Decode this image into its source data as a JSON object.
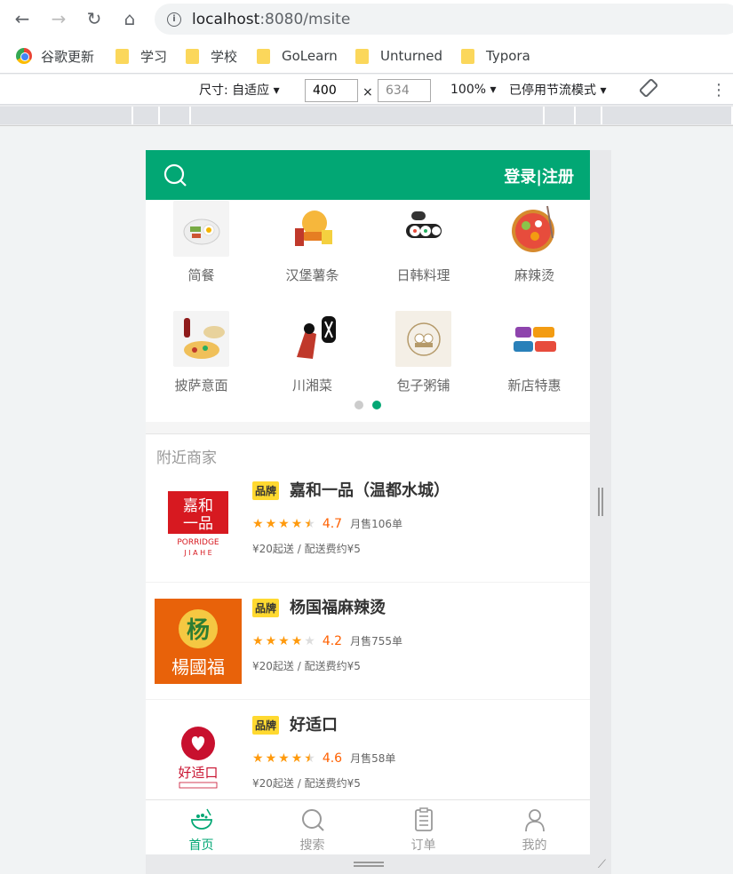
{
  "browser": {
    "url_host": "localhost",
    "url_rest": ":8080/msite",
    "bookmarks": [
      "谷歌更新",
      "学习",
      "学校",
      "GoLearn",
      "Unturned",
      "Typora"
    ]
  },
  "devtools": {
    "size_label": "尺寸: 自适应 ▾",
    "width": "400",
    "x": "×",
    "height": "634",
    "zoom": "100% ▾",
    "throttle": "已停用节流模式 ▾"
  },
  "header": {
    "login": "登录|注册"
  },
  "categories": [
    "简餐",
    "汉堡薯条",
    "日韩料理",
    "麻辣烫",
    "披萨意面",
    "川湘菜",
    "包子粥铺",
    "新店特惠"
  ],
  "section_title": "附近商家",
  "shops": [
    {
      "brand": "品牌",
      "name": "嘉和一品（温都水城）",
      "rating": "4.7",
      "sales": "月售106单",
      "fee": "¥20起送 / 配送费约¥5",
      "stars": [
        1,
        1,
        1,
        1,
        0.5
      ]
    },
    {
      "brand": "品牌",
      "name": "杨国福麻辣烫",
      "rating": "4.2",
      "sales": "月售755单",
      "fee": "¥20起送 / 配送费约¥5",
      "stars": [
        1,
        1,
        1,
        1,
        0
      ]
    },
    {
      "brand": "品牌",
      "name": "好适口",
      "rating": "4.6",
      "sales": "月售58单",
      "fee": "¥20起送 / 配送费约¥5",
      "stars": [
        1,
        1,
        1,
        1,
        0.5
      ]
    }
  ],
  "footer": [
    "首页",
    "搜索",
    "订单",
    "我的"
  ],
  "colors": {
    "brand": "#02a774",
    "star": "#ff9a0d"
  }
}
